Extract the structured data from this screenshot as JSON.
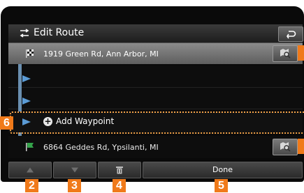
{
  "header": {
    "title": "Edit Route"
  },
  "route": {
    "start": {
      "address": "1919 Green Rd, Ann Arbor, MI"
    },
    "add_waypoint": {
      "label": "Add Waypoint"
    },
    "destination": {
      "address": "6864 Geddes Rd, Ypsilanti, MI"
    }
  },
  "footer": {
    "done_label": "Done"
  },
  "callouts": [
    "2",
    "3",
    "4",
    "5",
    "6"
  ],
  "colors": {
    "callout": "#f07a1a",
    "highlight_border": "#f5a44a",
    "start_row": "#7a7a7a",
    "route_line": "#6a8fb0",
    "destination_flag": "#34a34a"
  },
  "icons": {
    "title": "edit-route-icon",
    "back": "back-arrow-icon",
    "start": "checkered-flag-icon",
    "destination": "green-flag-icon",
    "map": "map-search-icon",
    "add": "plus-circle-icon",
    "up": "triangle-up-icon",
    "down": "triangle-down-icon",
    "delete": "trash-icon"
  }
}
